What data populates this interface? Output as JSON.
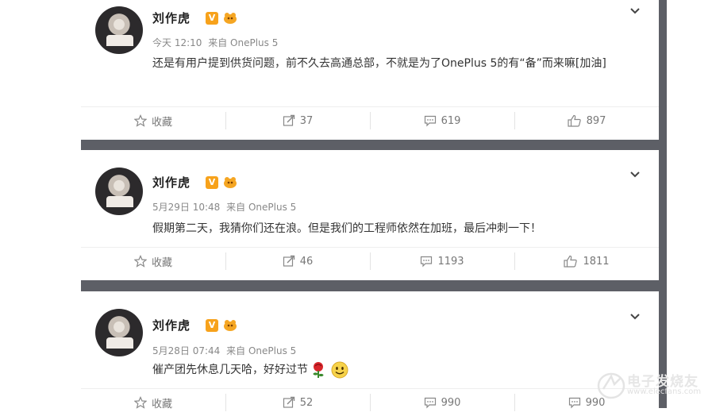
{
  "posts": [
    {
      "author": "刘作虎",
      "badge": "V",
      "time": "今天 12:10",
      "via": "来自 OnePlus 5",
      "text": "还是有用户提到供货问题，前不久去高通总部，不就是为了OnePlus 5的有“备”而来嘛[加油]",
      "favorite_label": "收藏",
      "repost_count": "37",
      "comment_count": "619",
      "like_count": "897"
    },
    {
      "author": "刘作虎",
      "badge": "V",
      "time": "5月29日 10:48",
      "via": "来自 OnePlus 5",
      "text": "假期第二天，我猜你们还在浪。但是我们的工程师依然在加班，最后冲刺一下！",
      "favorite_label": "收藏",
      "repost_count": "46",
      "comment_count": "1193",
      "like_count": "1811"
    },
    {
      "author": "刘作虎",
      "badge": "V",
      "time": "5月28日 07:44",
      "via": "来自 OnePlus 5",
      "text": "催产团先休息几天哈，好好过节",
      "favorite_label": "收藏",
      "repost_count": "52",
      "comment_count": "990",
      "like_count": "990"
    }
  ],
  "watermark": {
    "name": "电子发烧友",
    "url": "www.elecfans.com"
  },
  "colors": {
    "stage": "#5d5f66",
    "badge": "#f7a21b",
    "meta": "#888888"
  }
}
